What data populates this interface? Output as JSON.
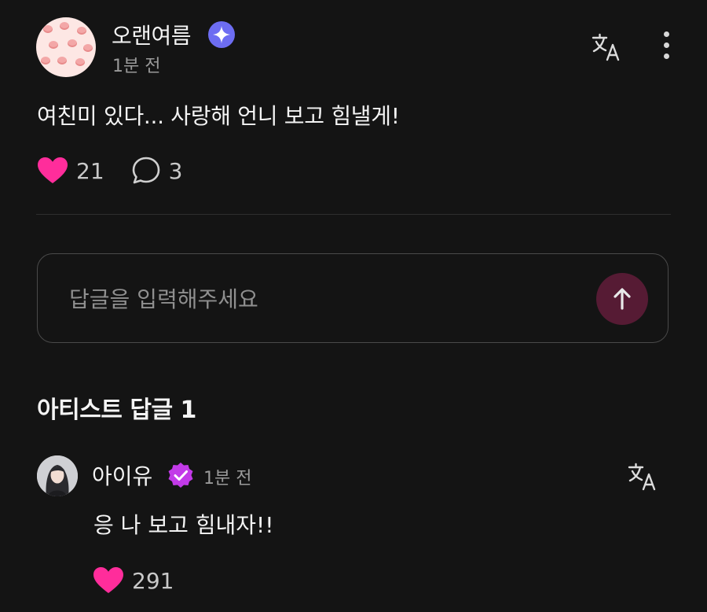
{
  "post": {
    "author": "오랜여름",
    "time": "1분 전",
    "body": "여친미 있다... 사랑해 언니 보고 힘낼게!",
    "likes": "21",
    "comments": "3"
  },
  "reply_input": {
    "placeholder": "답글을 입력해주세요"
  },
  "artist_replies": {
    "title": "아티스트 답글 1",
    "items": [
      {
        "author": "아이유",
        "time": "1분 전",
        "body": "응 나 보고 힘내자!!",
        "likes": "291"
      }
    ]
  },
  "colors": {
    "background": "#141414",
    "heart": "#ff2d9b",
    "send_button": "#561b34",
    "verified_badge": "#6d6df2",
    "artist_badge": "#c23ae8"
  },
  "icons": {
    "verified": "sparkle-badge-icon",
    "translate": "translate-icon",
    "more": "more-vertical-icon",
    "like": "heart-icon",
    "comment": "comment-bubble-icon",
    "send": "arrow-up-icon",
    "artist": "artist-check-badge-icon"
  }
}
